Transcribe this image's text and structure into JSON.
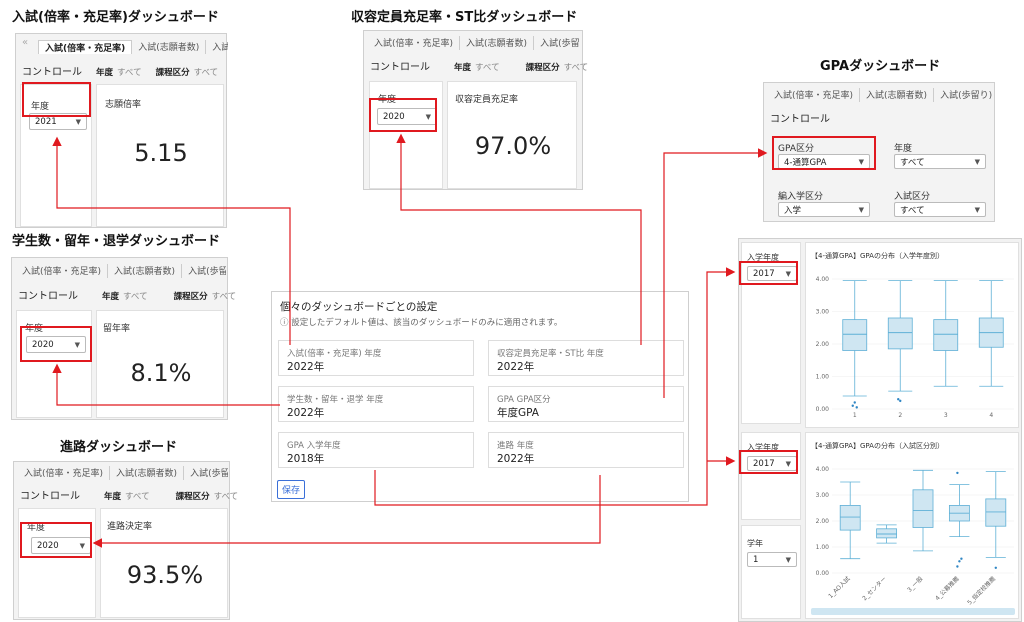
{
  "admission": {
    "title": "入試(倍率・充足率)ダッシュボード",
    "tabs": [
      "入試(倍率・充足率)",
      "入試(志願者数)",
      "入試(歩"
    ],
    "control": "コントロール",
    "year_label": "年度",
    "year_all": "すべて",
    "course_label": "課程区分",
    "course_all": "すべて",
    "field_label": "年度",
    "field_value": "2021",
    "metric_label": "志願倍率",
    "metric_value": "5.15"
  },
  "capacity": {
    "title": "収容定員充足率・ST比ダッシュボード",
    "tabs": [
      "入試(倍率・充足率)",
      "入試(志願者数)",
      "入試(歩留り)"
    ],
    "control": "コントロール",
    "year_label": "年度",
    "year_all": "すべて",
    "course_label": "課程区分",
    "course_all": "すべて",
    "field_label": "年度",
    "field_value": "2020",
    "metric_label": "収容定員充足率",
    "metric_value": "97.0%"
  },
  "gpa": {
    "title": "GPAダッシュボード",
    "tabs": [
      "入試(倍率・充足率)",
      "入試(志願者数)",
      "入試(歩留り)"
    ],
    "control": "コントロール",
    "gpa_label": "GPA区分",
    "gpa_value": "4-通算GPA",
    "year_label": "年度",
    "year_value": "すべて",
    "transfer_label": "編入学区分",
    "transfer_value": "入学",
    "exam_label": "入試区分",
    "exam_value": "すべて"
  },
  "students": {
    "title": "学生数・留年・退学ダッシュボード",
    "tabs": [
      "入試(倍率・充足率)",
      "入試(志願者数)",
      "入試(歩留り)"
    ],
    "control": "コントロール",
    "year_label": "年度",
    "year_all": "すべて",
    "course_label": "課程区分",
    "course_all": "すべて",
    "field_label": "年度",
    "field_value": "2020",
    "metric_label": "留年率",
    "metric_value": "8.1%"
  },
  "career": {
    "title": "進路ダッシュボード",
    "tabs": [
      "入試(倍率・充足率)",
      "入試(志願者数)",
      "入試(歩留り)"
    ],
    "control": "コントロール",
    "year_label": "年度",
    "year_all": "すべて",
    "course_label": "課程区分",
    "course_all": "すべて",
    "field_label": "年度",
    "field_value": "2020",
    "metric_label": "進路決定率",
    "metric_value": "93.5%"
  },
  "settings": {
    "title": "個々のダッシュボードごとの設定",
    "note": "ⓘ 設定したデフォルト値は、該当のダッシュボードのみに適用されます。",
    "fields": [
      {
        "label": "入試(倍率・充足率) 年度",
        "value": "2022年"
      },
      {
        "label": "収容定員充足率・ST比 年度",
        "value": "2022年"
      },
      {
        "label": "学生数・留年・退学 年度",
        "value": "2022年"
      },
      {
        "label": "GPA GPA区分",
        "value": "年度GPA"
      },
      {
        "label": "GPA 入学年度",
        "value": "2018年"
      },
      {
        "label": "進路 年度",
        "value": "2022年"
      }
    ],
    "save": "保存"
  },
  "boxplots": {
    "top": {
      "side_label": "入学年度",
      "side_value": "2017",
      "chart_title": "【4-通算GPA】GPAの分布（入学年度別）"
    },
    "bottom": {
      "side_label": "入学年度",
      "side_value": "2017",
      "side_label2": "学年",
      "side_value2": "1",
      "chart_title": "【4-通算GPA】GPAの分布（入試区分別）"
    },
    "colors": {
      "box_fill": "#cfe6f2",
      "box_stroke": "#5fb0d6",
      "outlier": "#2f86c4"
    }
  },
  "chart_data": [
    {
      "type": "box",
      "title": "【4-通算GPA】GPAの分布（入学年度別）",
      "categories": [
        "1",
        "2",
        "3",
        "4"
      ],
      "yticks": [
        "0.00",
        "1.00",
        "2.00",
        "3.00",
        "4.00"
      ],
      "ylim": [
        0,
        4
      ],
      "boxes": [
        {
          "min": 0.4,
          "q1": 1.8,
          "median": 2.3,
          "q3": 2.75,
          "max": 3.95
        },
        {
          "min": 0.55,
          "q1": 1.85,
          "median": 2.35,
          "q3": 2.8,
          "max": 3.95
        },
        {
          "min": 0.7,
          "q1": 1.8,
          "median": 2.3,
          "q3": 2.75,
          "max": 3.95
        },
        {
          "min": 0.7,
          "q1": 1.9,
          "median": 2.35,
          "q3": 2.8,
          "max": 3.95
        }
      ],
      "outliers": [
        [
          1,
          0.1
        ],
        [
          1,
          0.2
        ],
        [
          1,
          0.05
        ],
        [
          2,
          0.3
        ],
        [
          2,
          0.25
        ]
      ]
    },
    {
      "type": "box",
      "title": "【4-通算GPA】GPAの分布（入試区分別）",
      "categories": [
        "1_AO入試",
        "2_センター",
        "3_一般",
        "4_公募推薦",
        "5_指定校推薦"
      ],
      "yticks": [
        "0.00",
        "1.00",
        "2.00",
        "3.00",
        "4.00"
      ],
      "ylim": [
        0,
        4
      ],
      "boxes": [
        {
          "min": 0.55,
          "q1": 1.65,
          "median": 2.15,
          "q3": 2.6,
          "max": 3.5
        },
        {
          "min": 1.15,
          "q1": 1.35,
          "median": 1.5,
          "q3": 1.7,
          "max": 1.85
        },
        {
          "min": 0.85,
          "q1": 1.75,
          "median": 2.4,
          "q3": 3.2,
          "max": 3.95
        },
        {
          "min": 1.4,
          "q1": 2.0,
          "median": 2.3,
          "q3": 2.6,
          "max": 3.4
        },
        {
          "min": 0.6,
          "q1": 1.8,
          "median": 2.35,
          "q3": 2.85,
          "max": 3.9
        }
      ],
      "outliers": [
        [
          4,
          0.25
        ],
        [
          4,
          0.45
        ],
        [
          4,
          0.55
        ],
        [
          4,
          3.85
        ],
        [
          5,
          0.2
        ]
      ]
    }
  ]
}
